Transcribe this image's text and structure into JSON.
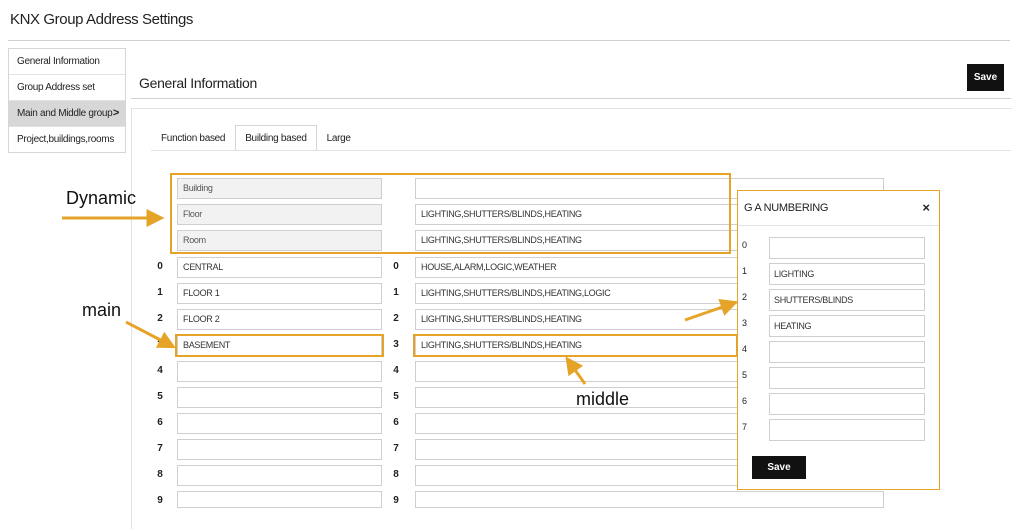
{
  "page": {
    "title": "KNX Group Address Settings"
  },
  "sidebar": {
    "items": [
      {
        "label": "General Information"
      },
      {
        "label": "Group Address set"
      },
      {
        "label": "Main and Middle group",
        "chevron": ">"
      },
      {
        "label": "Project,buildings,rooms"
      }
    ]
  },
  "header": {
    "section_title": "General Information",
    "save_label": "Save"
  },
  "tabs": [
    {
      "label": "Function based"
    },
    {
      "label": "Building based"
    },
    {
      "label": "Large"
    }
  ],
  "dynamic": {
    "labels": [
      "Building",
      "Floor",
      "Room"
    ],
    "values": [
      "",
      "LIGHTING,SHUTTERS/BLINDS,HEATING",
      "LIGHTING,SHUTTERS/BLINDS,HEATING"
    ]
  },
  "rows": [
    {
      "index": "0",
      "main": "CENTRAL",
      "middle": "HOUSE,ALARM,LOGIC,WEATHER"
    },
    {
      "index": "1",
      "main": "FLOOR 1",
      "middle": "LIGHTING,SHUTTERS/BLINDS,HEATING,LOGIC"
    },
    {
      "index": "2",
      "main": "FLOOR 2",
      "middle": "LIGHTING,SHUTTERS/BLINDS,HEATING"
    },
    {
      "index": "3",
      "main": "BASEMENT",
      "middle": "LIGHTING,SHUTTERS/BLINDS,HEATING"
    },
    {
      "index": "4",
      "main": "",
      "middle": ""
    },
    {
      "index": "5",
      "main": "",
      "middle": ""
    },
    {
      "index": "6",
      "main": "",
      "middle": ""
    },
    {
      "index": "7",
      "main": "",
      "middle": ""
    },
    {
      "index": "8",
      "main": "",
      "middle": ""
    },
    {
      "index": "9",
      "main": "",
      "middle": ""
    }
  ],
  "callouts": {
    "dynamic": "Dynamic",
    "main": "main",
    "middle": "middle"
  },
  "modal": {
    "title": "G A NUMBERING",
    "close_icon": "×",
    "save_label": "Save",
    "rows": [
      {
        "index": "0",
        "value": ""
      },
      {
        "index": "1",
        "value": "LIGHTING"
      },
      {
        "index": "2",
        "value": "SHUTTERS/BLINDS"
      },
      {
        "index": "3",
        "value": "HEATING"
      },
      {
        "index": "4",
        "value": ""
      },
      {
        "index": "5",
        "value": ""
      },
      {
        "index": "6",
        "value": ""
      },
      {
        "index": "7",
        "value": ""
      }
    ]
  },
  "colors": {
    "highlight": "#e5a427",
    "button": "#111111",
    "active_nav": "#d7d7d7"
  }
}
